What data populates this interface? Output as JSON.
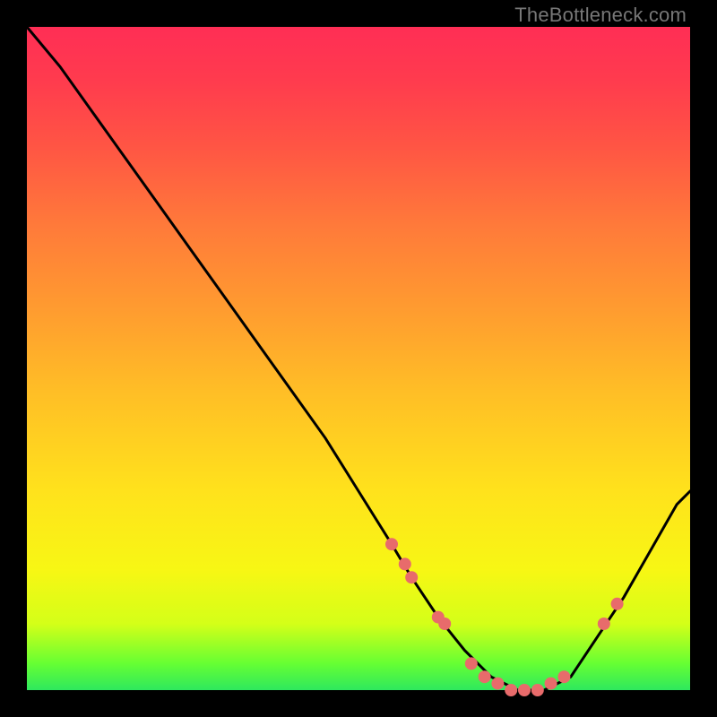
{
  "watermark": "TheBottleneck.com",
  "colors": {
    "accent_dot": "#e86b6b",
    "curve": "#000000",
    "background_stops": [
      "#ff2e55",
      "#ff7a3a",
      "#ffe21c",
      "#2ee85e"
    ]
  },
  "chart_data": {
    "type": "line",
    "title": "",
    "xlabel": "",
    "ylabel": "",
    "xlim": [
      0,
      100
    ],
    "ylim": [
      0,
      100
    ],
    "grid": false,
    "legend": "none",
    "note": "No axis ticks or numeric labels are rendered in the image; x/y are normalized 0–100. y≈0 means optimal (bottom, green), y≈100 means worst (top, red).",
    "series": [
      {
        "name": "bottleneck-curve",
        "x": [
          0,
          5,
          10,
          15,
          20,
          25,
          30,
          35,
          40,
          45,
          50,
          55,
          58,
          62,
          66,
          70,
          74,
          78,
          82,
          86,
          90,
          94,
          98,
          100
        ],
        "values": [
          100,
          94,
          87,
          80,
          73,
          66,
          59,
          52,
          45,
          38,
          30,
          22,
          17,
          11,
          6,
          2,
          0,
          0,
          2,
          8,
          14,
          21,
          28,
          30
        ]
      }
    ],
    "highlight_points": {
      "name": "marker-dots",
      "x": [
        55,
        57,
        58,
        62,
        63,
        67,
        69,
        71,
        73,
        75,
        77,
        79,
        81,
        87,
        89
      ],
      "values": [
        22,
        19,
        17,
        11,
        10,
        4,
        2,
        1,
        0,
        0,
        0,
        1,
        2,
        10,
        13
      ]
    }
  }
}
